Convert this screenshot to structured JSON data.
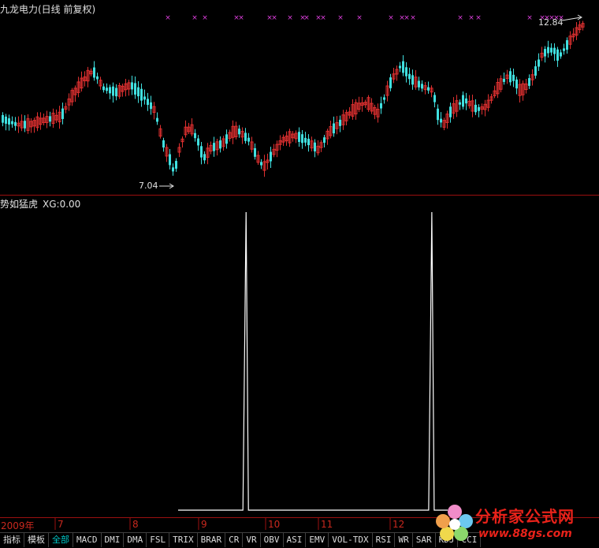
{
  "main_chart": {
    "title": "九龙电力(日线 前复权)",
    "high_label": "12.84",
    "low_label": "7.04"
  },
  "indicator": {
    "title": "势如猛虎",
    "value_label": "XG:0.00"
  },
  "date_axis": {
    "year_label": "2009年",
    "months": [
      "7",
      "8",
      "9",
      "10",
      "11",
      "12"
    ]
  },
  "tabs": [
    {
      "label": "指标"
    },
    {
      "label": "模板"
    },
    {
      "label": "全部",
      "active": true
    },
    {
      "label": "MACD"
    },
    {
      "label": "DMI"
    },
    {
      "label": "DMA"
    },
    {
      "label": "FSL"
    },
    {
      "label": "TRIX"
    },
    {
      "label": "BRAR"
    },
    {
      "label": "CR"
    },
    {
      "label": "VR"
    },
    {
      "label": "OBV"
    },
    {
      "label": "ASI"
    },
    {
      "label": "EMV"
    },
    {
      "label": "VOL-TDX"
    },
    {
      "label": "RSI"
    },
    {
      "label": "WR"
    },
    {
      "label": "SAR"
    },
    {
      "label": "KDJ"
    },
    {
      "label": "CCI"
    }
  ],
  "watermark": {
    "text": "分析家公式网",
    "url": "www.88gs.com"
  },
  "colors": {
    "up": "#e03030",
    "down": "#40e0e0",
    "marker": "#e040e0",
    "grid_line": "#9c1010",
    "axis_text": "#c8281e",
    "tab_active": "#00c8c8"
  },
  "chart_data": {
    "type": "line",
    "title": "",
    "series": [
      {
        "name": "XG",
        "x": [
          "2009-09-01",
          "2009-09-15",
          "2009-09-29",
          "2009-10-01",
          "2009-10-06",
          "2009-10-15",
          "2009-11-02",
          "2009-11-16",
          "2009-12-01",
          "2009-12-16",
          "2009-12-22",
          "2009-12-24",
          "2009-12-29"
        ],
        "values": [
          0,
          0,
          0,
          1,
          0,
          0,
          0,
          0,
          0,
          0,
          1,
          0,
          0
        ]
      }
    ],
    "ylim": [
      0,
      1
    ],
    "grid": false
  }
}
